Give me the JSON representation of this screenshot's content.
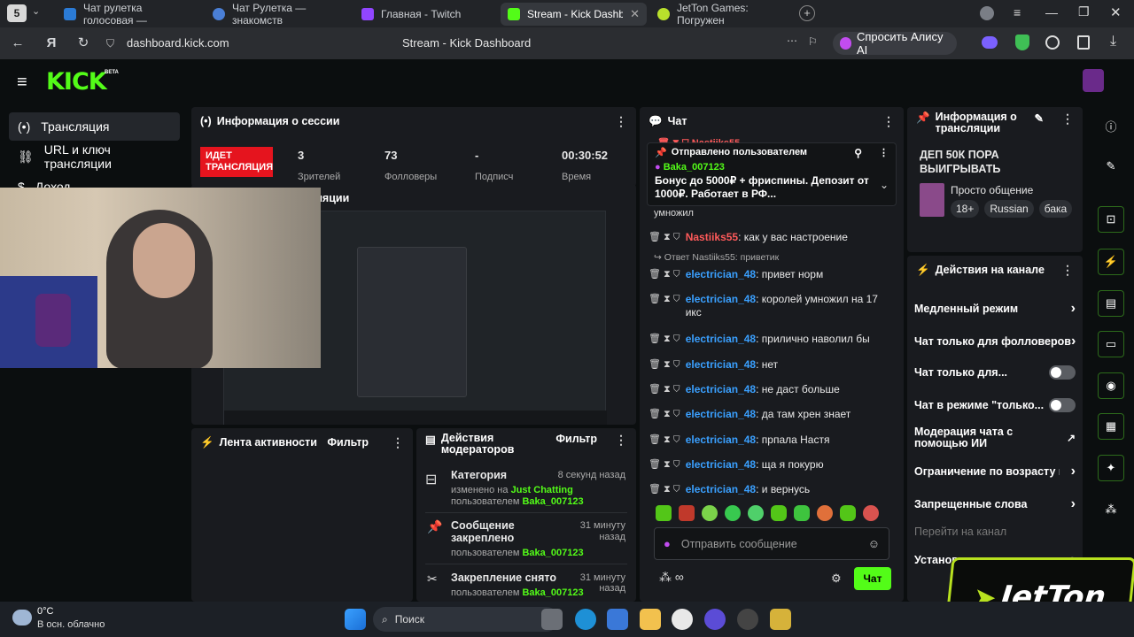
{
  "browser": {
    "tab_count": "5",
    "tabs": [
      {
        "title": "Чат рулетка голосовая —"
      },
      {
        "title": "Чат Рулетка — знакомств"
      },
      {
        "title": "Главная - Twitch"
      },
      {
        "title": "Stream - Kick Dashboard"
      },
      {
        "title": "JetTon Games: Погружен"
      }
    ],
    "url": "dashboard.kick.com",
    "page_title": "Stream - Kick Dashboard",
    "alice_label": "Спросить Алису AI"
  },
  "kick": {
    "logo": "KICK",
    "logo_badge": "BETA",
    "sidebar": [
      {
        "label": "Трансляция"
      },
      {
        "label": "URL и ключ трансляции"
      },
      {
        "label": "Доход"
      }
    ],
    "session": {
      "title": "Информация о сессии",
      "live_badge": "ИДЕТ ТРАНСЛЯЦИЯ",
      "stats": [
        {
          "value": "3",
          "label": "Зрителей"
        },
        {
          "value": "73",
          "label": "Фолловеры"
        },
        {
          "value": "-",
          "label": "Подписч"
        },
        {
          "value": "00:30:52",
          "label": "Время"
        }
      ]
    },
    "preview_title": "Предпросмотр трансляции",
    "activity": {
      "title": "Лента активности",
      "filter": "Фильтр"
    },
    "mod_actions": {
      "title": "Действия модераторов",
      "filter": "Фильтр",
      "items": [
        {
          "title": "Категория",
          "time": "8 секунд назад",
          "line1_prefix": "изменено на",
          "line1_value": "Just Chatting",
          "line2_prefix": "пользователем",
          "line2_value": "Baka_007123"
        },
        {
          "title": "Сообщение закреплено",
          "time": "31 минуту назад",
          "line2_prefix": "пользователем",
          "line2_value": "Baka_007123"
        },
        {
          "title": "Закрепление снято",
          "time": "31 минуту назад",
          "line2_prefix": "пользователем",
          "line2_value": "Baka_007123"
        }
      ]
    },
    "chat": {
      "title": "Чат",
      "pinned_header": "Отправлено пользователем",
      "pinned_user": "Baka_007123",
      "pinned_text": "Бонус до 5000₽ + фриспины. Депозит от 1000₽. Работает в РФ...",
      "partial_top": "Nastiiks55",
      "partial_text": "умножил",
      "reply_label": "Ответ Nastiiks55: приветик",
      "messages": [
        {
          "user": "Nastiiks55",
          "text": ": как у вас настроение"
        },
        {
          "user": "electrician_48",
          "text": ": привет норм"
        },
        {
          "user": "electrician_48",
          "text": ": королей умножил на 17 икс"
        },
        {
          "user": "electrician_48",
          "text": ": прилично наволил бы"
        },
        {
          "user": "electrician_48",
          "text": ": нет"
        },
        {
          "user": "electrician_48",
          "text": ": не даст больше"
        },
        {
          "user": "electrician_48",
          "text": ": да там хрен знает"
        },
        {
          "user": "electrician_48",
          "text": ": прпала Настя"
        },
        {
          "user": "electrician_48",
          "text": ": ща я покурю"
        },
        {
          "user": "electrician_48",
          "text": ": и вернусь"
        }
      ],
      "input_placeholder": "Отправить сообщение",
      "send_label": "Чат"
    },
    "stream_info": {
      "title": "Информация о трансляции",
      "stream_title": "ДЕП 50К ПОРА ВЫИГРЫВАТЬ",
      "category": "Просто общение",
      "tags": [
        "18+",
        "Russian",
        "бака"
      ]
    },
    "channel_actions": {
      "title": "Действия на канале",
      "items": [
        {
          "label": "Медленный режим",
          "kind": "chevron"
        },
        {
          "label": "Чат только для фолловеров",
          "kind": "chevron"
        },
        {
          "label": "Чат только для...",
          "kind": "toggle"
        },
        {
          "label": "Чат в режиме \"только...",
          "kind": "toggle"
        },
        {
          "label": "Модерация чата с помощью ИИ",
          "kind": "external"
        },
        {
          "label": "Ограничение по возрасту и",
          "kind": "chevron"
        },
        {
          "label": "Запрещенные слова",
          "kind": "chevron"
        },
        {
          "label": "Перейти на канал",
          "kind": "muted"
        },
        {
          "label": "Установить цели",
          "kind": "chevron"
        }
      ]
    }
  },
  "overlay": {
    "brand": "JetTon"
  },
  "taskbar": {
    "temp": "0°C",
    "weather": "В осн. облачно",
    "search": "Поиск"
  },
  "colors": {
    "kick_green": "#53fc18",
    "live_red": "#e5141e",
    "user_blue": "#3aa0ff",
    "user_red": "#ff5a5a"
  }
}
